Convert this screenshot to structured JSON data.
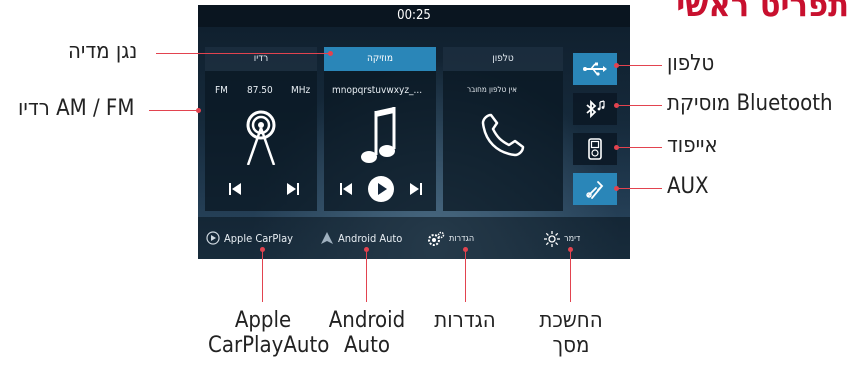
{
  "heading": "תפריט ראשי",
  "screen": {
    "time": "00:25",
    "panels": {
      "radio": {
        "header": "רדיו",
        "band": "FM",
        "frequency": "87.50",
        "unit": "MHz"
      },
      "music": {
        "header": "מוזיקה",
        "track": "mnopqrstuvwxyz_..."
      },
      "phone": {
        "header": "טלפון",
        "status": "אין טלפון מחובר"
      }
    },
    "sidebar": [
      {
        "icon": "usb-icon",
        "active": true
      },
      {
        "icon": "bluetooth-music-icon",
        "active": false
      },
      {
        "icon": "ipod-icon",
        "active": false
      },
      {
        "icon": "aux-icon",
        "active": true
      }
    ],
    "footer": {
      "carplay": "Apple CarPlay",
      "android": "Android Auto",
      "settings": "הגדרות",
      "dimmer": "דימר"
    }
  },
  "annotations": {
    "media_player": "נגן מדיה",
    "radio": "רדיו AM / FM",
    "phone": "טלפון",
    "bt_music": "מוסיקת Bluetooth",
    "ipod": "אייפוד",
    "aux": "AUX",
    "carplay": "Apple CarPlayAuto",
    "android": "Android Auto",
    "settings": "הגדרות",
    "dimmer": "החשכת מסך"
  },
  "colors": {
    "accent": "#2a86b8",
    "leader": "#e2434f",
    "heading": "#c8102e"
  }
}
